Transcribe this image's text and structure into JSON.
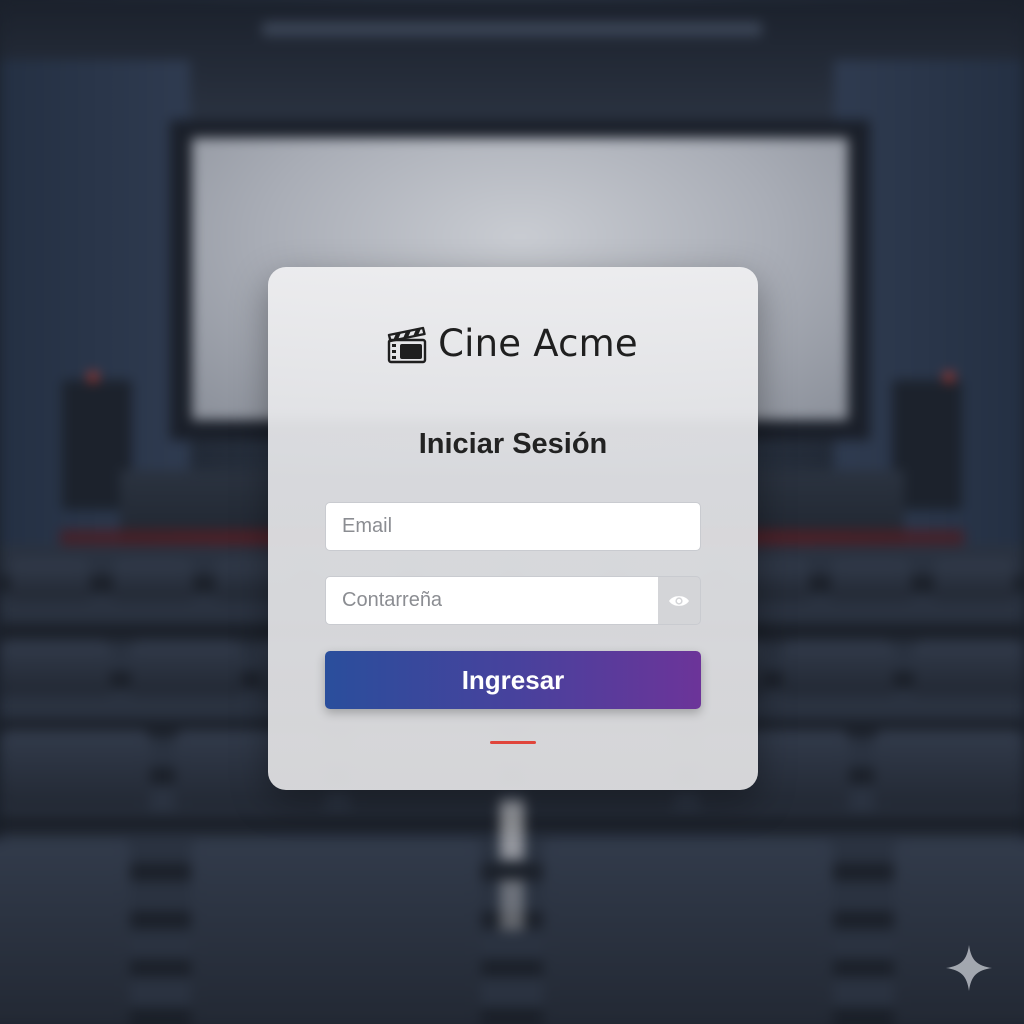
{
  "brand": {
    "name": "Cine Acme",
    "icon": "clapperboard-icon"
  },
  "login": {
    "title": "Iniciar Sesión",
    "email_placeholder": "Email",
    "password_placeholder": "Contarreña",
    "show_password_icon": "eye-icon",
    "submit_label": "Ingresar"
  },
  "colors": {
    "button_gradient_start": "#2a4e9c",
    "button_gradient_end": "#6c3499",
    "accent": "#e0453b"
  },
  "decor": {
    "corner_icon": "sparkle-icon"
  }
}
